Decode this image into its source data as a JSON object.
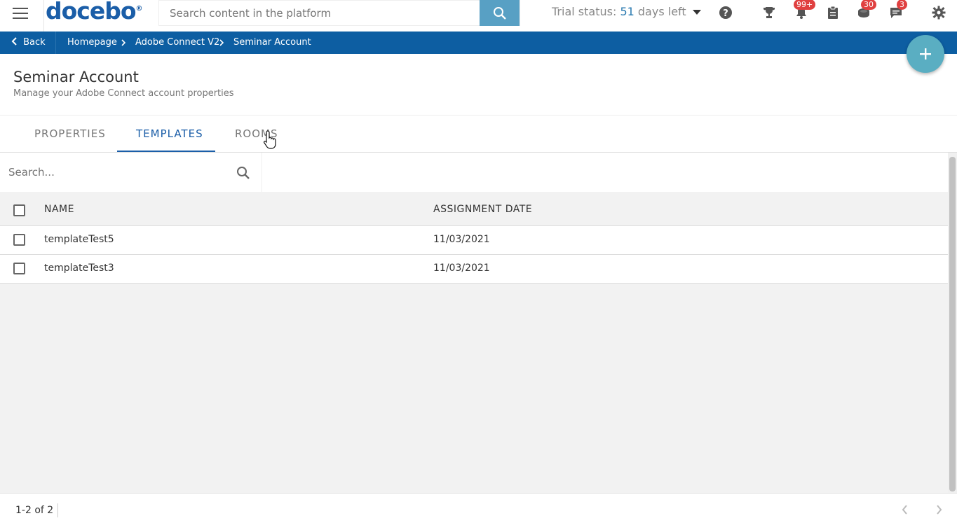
{
  "topbar": {
    "logo_text": "docebo",
    "logo_mark": "®",
    "search_placeholder": "Search content in the platform",
    "trial_prefix": "Trial status:",
    "trial_days": "51",
    "trial_suffix": "days left",
    "badges": {
      "notifications": "99+",
      "gamification": "30",
      "messages": "3"
    },
    "accent_color": "#0d5ea2"
  },
  "breadcrumb": {
    "back_label": "Back",
    "items": [
      "Homepage",
      "Adobe Connect V2",
      "Seminar Account"
    ]
  },
  "page": {
    "title": "Seminar Account",
    "subtitle": "Manage your Adobe Connect account properties"
  },
  "tabs": [
    {
      "label": "PROPERTIES",
      "active": false
    },
    {
      "label": "TEMPLATES",
      "active": true
    },
    {
      "label": "ROOMS",
      "active": false
    }
  ],
  "filter": {
    "search_placeholder": "Search..."
  },
  "table": {
    "columns": [
      "NAME",
      "ASSIGNMENT DATE"
    ],
    "rows": [
      {
        "name": "templateTest5",
        "date": "11/03/2021"
      },
      {
        "name": "templateTest3",
        "date": "11/03/2021"
      }
    ]
  },
  "pagination": {
    "summary": "1-2 of 2"
  },
  "icons": {
    "menu": "hamburger-menu-icon",
    "search": "search-icon",
    "help": "help-icon",
    "trophy": "trophy-icon",
    "notifications": "bell-icon",
    "clipboard": "clipboard-icon",
    "gamification": "coin-stack-icon",
    "messages": "chat-icon",
    "settings": "gear-icon",
    "add": "plus-icon"
  }
}
